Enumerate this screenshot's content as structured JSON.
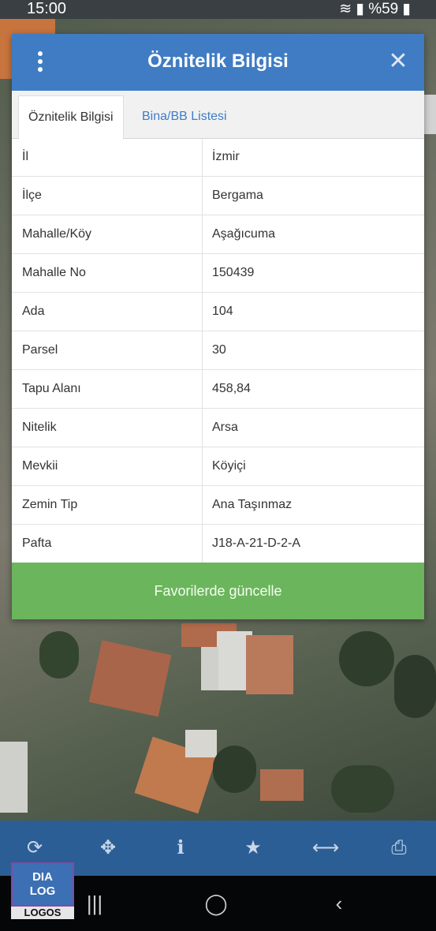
{
  "status_bar": {
    "time": "15:00",
    "indicators": "%59"
  },
  "dialog": {
    "title": "Öznitelik Bilgisi",
    "tabs": [
      {
        "label": "Öznitelik Bilgisi",
        "active": true
      },
      {
        "label": "Bina/BB Listesi",
        "active": false
      }
    ],
    "rows": [
      {
        "key": "İl",
        "value": "İzmir"
      },
      {
        "key": "İlçe",
        "value": "Bergama"
      },
      {
        "key": "Mahalle/Köy",
        "value": "Aşağıcuma"
      },
      {
        "key": "Mahalle No",
        "value": "150439"
      },
      {
        "key": "Ada",
        "value": "104"
      },
      {
        "key": "Parsel",
        "value": "30"
      },
      {
        "key": "Tapu Alanı",
        "value": "458,84"
      },
      {
        "key": "Nitelik",
        "value": "Arsa"
      },
      {
        "key": "Mevkii",
        "value": "Köyiçi"
      },
      {
        "key": "Zemin Tip",
        "value": "Ana Taşınmaz"
      },
      {
        "key": "Pafta",
        "value": "J18-A-21-D-2-A"
      }
    ],
    "update_button": "Favorilerde güncelle"
  },
  "toolbar": {
    "icons": [
      "refresh-icon",
      "locate-icon",
      "info-icon",
      "star-icon",
      "measure-icon",
      "print-icon"
    ]
  },
  "logo": {
    "line1": "DIA",
    "line2": "LOG",
    "bottom": "LOGOS"
  },
  "colors": {
    "header": "#3f7cc4",
    "button": "#6bb55c",
    "toolbar": "#2c5e96"
  }
}
